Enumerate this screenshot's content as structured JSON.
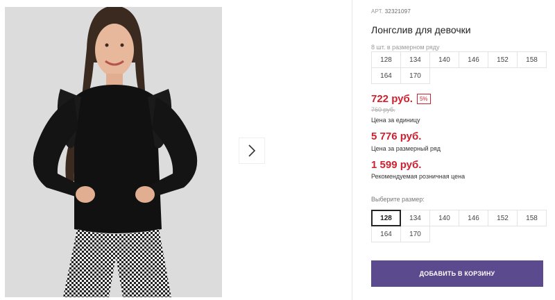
{
  "product": {
    "art_label": "АРТ.",
    "art_number": "32321097",
    "title": "Лонгслив для девочки"
  },
  "size_row": {
    "note": "8 шт. в размерном ряду",
    "sizes": [
      "128",
      "134",
      "140",
      "146",
      "152",
      "158",
      "164",
      "170"
    ]
  },
  "pricing": {
    "unit_price": "722 руб.",
    "discount_badge": "5%",
    "old_price": "760 руб.",
    "unit_label": "Цена за единицу",
    "row_price": "5 776 руб.",
    "row_label": "Цена за размерный ряд",
    "retail_price": "1 599 руб.",
    "retail_label": "Рекомендуемая розничная цена"
  },
  "size_picker": {
    "label": "Выберите размер:",
    "sizes": [
      "128",
      "134",
      "140",
      "146",
      "152",
      "158",
      "164",
      "170"
    ],
    "selected": "128"
  },
  "cart_button_label": "ДОБАВИТЬ В КОРЗИНУ",
  "colors": {
    "price_red": "#d0202e",
    "button_purple": "#5c4a8e"
  },
  "icons": {
    "gallery_next": "chevron-right-icon"
  }
}
